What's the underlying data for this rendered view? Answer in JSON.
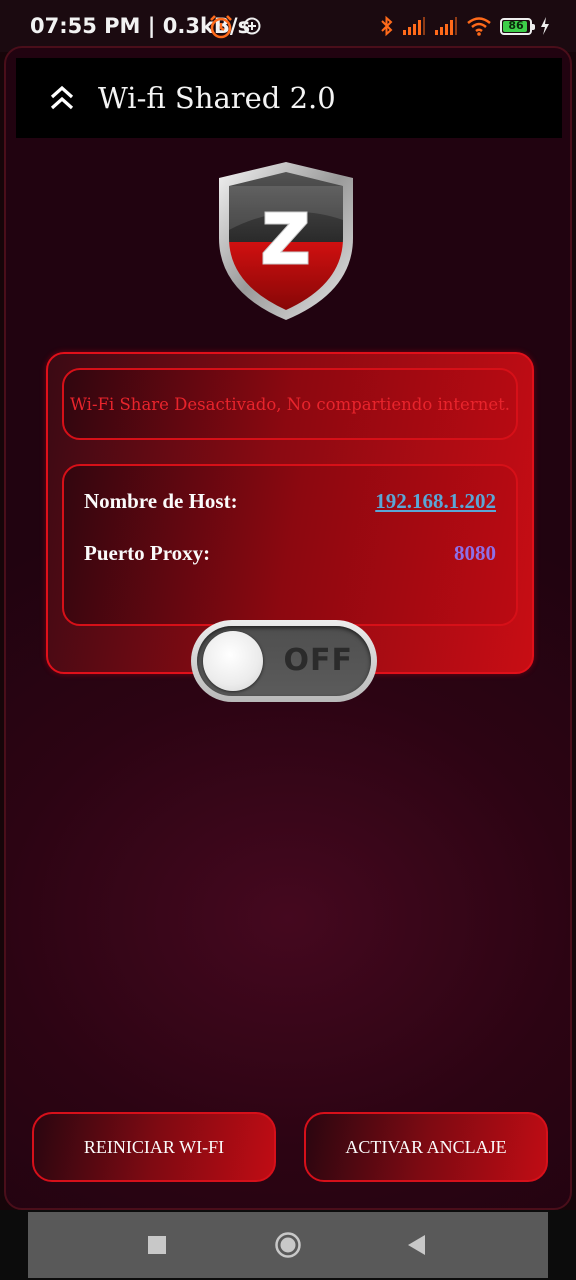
{
  "status_bar": {
    "time": "07:55 PM | 0.3kB/s",
    "battery": "86",
    "icons": [
      "alarm-icon",
      "plus-circle-icon",
      "bluetooth-icon",
      "signal-icon",
      "signal-icon",
      "wifi-icon",
      "battery-icon",
      "charging-icon"
    ]
  },
  "header": {
    "title": "Wi-fi Shared 2.0",
    "back_icon": "double-chevron-up-icon"
  },
  "logo": {
    "letter": "Z"
  },
  "status": {
    "message": "Wi-Fi Share Desactivado, No compartiendo internet."
  },
  "info": {
    "host_label": "Nombre de Host:",
    "host_value": "192.168.1.202",
    "port_label": "Puerto Proxy:",
    "port_value": "8080"
  },
  "toggle": {
    "label": "OFF",
    "state": "off"
  },
  "buttons": {
    "restart_wifi": "REINICIAR WI-FI",
    "activate_tether": "ACTIVAR ANCLAJE"
  },
  "colors": {
    "accent_red": "#e0101a",
    "status_text": "#e8242c",
    "host_link": "#5aa6d6",
    "port_value": "#8e6fe6",
    "battery_green": "#3ecf4a"
  }
}
